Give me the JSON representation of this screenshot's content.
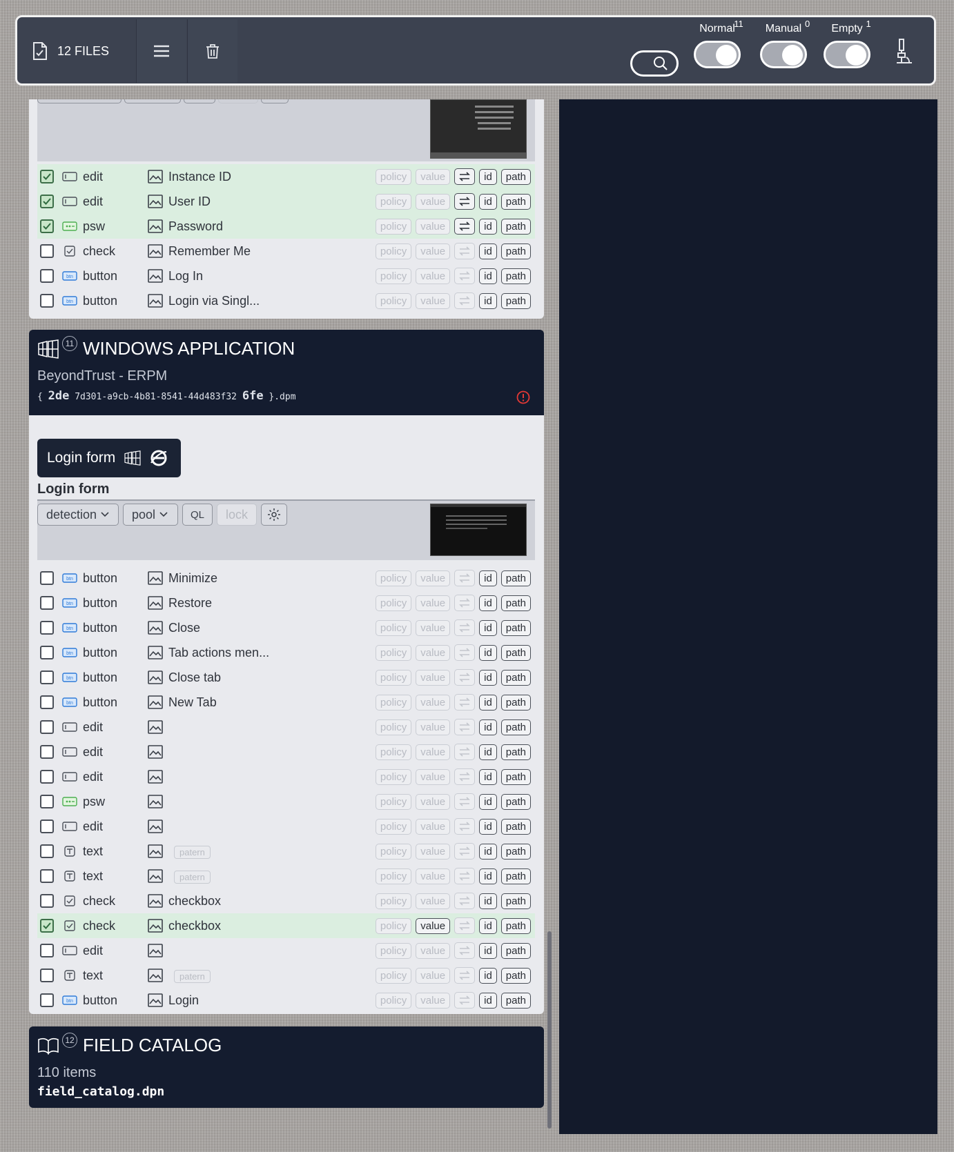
{
  "topbar": {
    "files_label": "12 FILES",
    "toggles": [
      {
        "label": "Normal",
        "count": "11"
      },
      {
        "label": "Manual",
        "count": "0"
      },
      {
        "label": "Empty",
        "count": "1"
      }
    ]
  },
  "top_chips": {
    "policy": "policy",
    "value": "value",
    "id": "id",
    "path": "path"
  },
  "form1_rows": [
    {
      "checked": true,
      "type": "edit",
      "icon": "edit-field-icon",
      "label": "Instance ID",
      "value_active": false,
      "arrow_active": true
    },
    {
      "checked": true,
      "type": "edit",
      "icon": "edit-field-icon",
      "label": "User ID",
      "value_active": false,
      "arrow_active": true
    },
    {
      "checked": true,
      "type": "psw",
      "icon": "password-field-icon",
      "label": "Password",
      "value_active": false,
      "arrow_active": true
    },
    {
      "checked": false,
      "type": "check",
      "icon": "checkbox-type-icon",
      "label": "Remember Me",
      "value_active": false,
      "arrow_active": false
    },
    {
      "checked": false,
      "type": "button",
      "icon": "button-type-icon",
      "label": "Log In",
      "value_active": false,
      "arrow_active": false
    },
    {
      "checked": false,
      "type": "button",
      "icon": "button-type-icon",
      "label": "Login via Singl...",
      "value_active": false,
      "arrow_active": false
    }
  ],
  "windows_app": {
    "badge": "11",
    "title": "WINDOWS APPLICATION",
    "subtitle": "BeyondTrust - ERPM",
    "file_open": "{",
    "file_start": "2de",
    "file_mid": "7d301-a9cb-4b81-8541-44d483f32",
    "file_end": "6fe",
    "file_close": "}.dpm"
  },
  "login_tab": {
    "label": "Login form"
  },
  "form2": {
    "title": "Login form",
    "controls": {
      "detection": "detection",
      "pool": "pool",
      "ql": "QL",
      "lock": "lock"
    },
    "rows": [
      {
        "checked": false,
        "type": "button",
        "icon": "button-type-icon",
        "label": "Minimize",
        "patern": "",
        "value_active": false
      },
      {
        "checked": false,
        "type": "button",
        "icon": "button-type-icon",
        "label": "Restore",
        "patern": "",
        "value_active": false
      },
      {
        "checked": false,
        "type": "button",
        "icon": "button-type-icon",
        "label": "Close",
        "patern": "",
        "value_active": false
      },
      {
        "checked": false,
        "type": "button",
        "icon": "button-type-icon",
        "label": "Tab actions men...",
        "patern": "",
        "value_active": false
      },
      {
        "checked": false,
        "type": "button",
        "icon": "button-type-icon",
        "label": "Close tab",
        "patern": "",
        "value_active": false
      },
      {
        "checked": false,
        "type": "button",
        "icon": "button-type-icon",
        "label": "New Tab",
        "patern": "",
        "value_active": false
      },
      {
        "checked": false,
        "type": "edit",
        "icon": "edit-field-icon",
        "label": "",
        "patern": "",
        "value_active": false
      },
      {
        "checked": false,
        "type": "edit",
        "icon": "edit-field-icon",
        "label": "",
        "patern": "",
        "value_active": false
      },
      {
        "checked": false,
        "type": "edit",
        "icon": "edit-field-icon",
        "label": "",
        "patern": "",
        "value_active": false
      },
      {
        "checked": false,
        "type": "psw",
        "icon": "password-field-icon",
        "label": "",
        "patern": "",
        "value_active": false
      },
      {
        "checked": false,
        "type": "edit",
        "icon": "edit-field-icon",
        "label": "",
        "patern": "",
        "value_active": false
      },
      {
        "checked": false,
        "type": "text",
        "icon": "text-type-icon",
        "label": "",
        "patern": "patern",
        "value_active": false
      },
      {
        "checked": false,
        "type": "text",
        "icon": "text-type-icon",
        "label": "",
        "patern": "patern",
        "value_active": false
      },
      {
        "checked": false,
        "type": "check",
        "icon": "checkbox-type-icon",
        "label": "checkbox",
        "patern": "",
        "value_active": false
      },
      {
        "checked": true,
        "type": "check",
        "icon": "checkbox-type-icon",
        "label": "checkbox",
        "patern": "",
        "value_active": true
      },
      {
        "checked": false,
        "type": "edit",
        "icon": "edit-field-icon",
        "label": "",
        "patern": "",
        "value_active": false
      },
      {
        "checked": false,
        "type": "text",
        "icon": "text-type-icon",
        "label": "",
        "patern": "patern",
        "value_active": false
      },
      {
        "checked": false,
        "type": "button",
        "icon": "button-type-icon",
        "label": "Login",
        "patern": "",
        "value_active": false
      }
    ]
  },
  "field_catalog": {
    "badge": "12",
    "title": "FIELD CATALOG",
    "subtitle": "110 items",
    "file": "field_catalog.dpn"
  },
  "colors": {
    "accent_dark": "#141c2f",
    "selected_row": "#dbeee0",
    "error": "#e53935"
  }
}
